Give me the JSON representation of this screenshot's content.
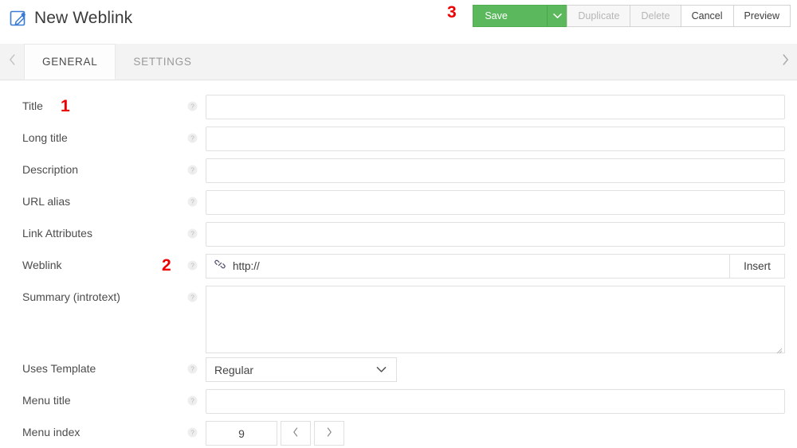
{
  "header": {
    "title": "New Weblink",
    "edit_icon": "edit-pencil-square-icon"
  },
  "toolbar": {
    "save_label": "Save",
    "save_caret_icon": "chevron-down-icon",
    "duplicate_label": "Duplicate",
    "delete_label": "Delete",
    "cancel_label": "Cancel",
    "preview_label": "Preview",
    "save_color": "#5cb85c"
  },
  "tabbar": {
    "scroll_left_icon": "chevron-left-icon",
    "scroll_right_icon": "chevron-right-icon",
    "tabs": [
      {
        "label": "GENERAL",
        "active": true
      },
      {
        "label": "SETTINGS",
        "active": false
      }
    ]
  },
  "form": {
    "help_icon": "question-circle-icon",
    "fields": {
      "title": {
        "label": "Title",
        "value": ""
      },
      "long_title": {
        "label": "Long title",
        "value": ""
      },
      "description": {
        "label": "Description",
        "value": ""
      },
      "url_alias": {
        "label": "URL alias",
        "value": ""
      },
      "link_attributes": {
        "label": "Link Attributes",
        "value": ""
      },
      "weblink": {
        "label": "Weblink",
        "value": "http://",
        "link_icon": "link-chain-icon",
        "insert_label": "Insert"
      },
      "summary": {
        "label": "Summary (introtext)",
        "value": ""
      },
      "uses_template": {
        "label": "Uses Template",
        "value": "Regular",
        "caret_icon": "chevron-down-icon"
      },
      "menu_title": {
        "label": "Menu title",
        "value": ""
      },
      "menu_index": {
        "label": "Menu index",
        "value": "9",
        "prev_icon": "chevron-left-icon",
        "next_icon": "chevron-right-icon"
      }
    }
  },
  "annotations": {
    "one": "1",
    "two": "2",
    "three": "3",
    "color": "#ee0000"
  }
}
